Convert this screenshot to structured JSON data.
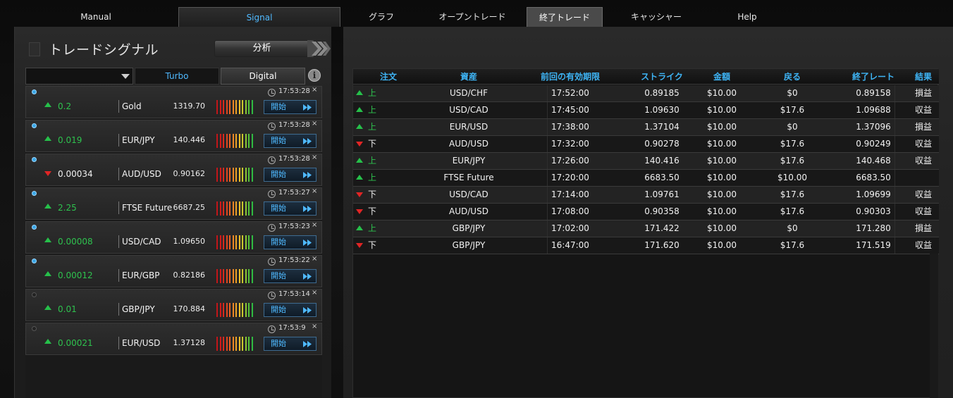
{
  "nav": {
    "tabs": [
      {
        "label": "Manual"
      },
      {
        "label": "Signal"
      },
      {
        "label": "グラフ"
      },
      {
        "label": "オープントレード"
      },
      {
        "label": "終了トレード"
      },
      {
        "label": "キャッシャー"
      },
      {
        "label": "Help"
      }
    ],
    "accent": "#4fb9ff"
  },
  "left": {
    "title": "トレードシグナル",
    "analyze_label": "分析",
    "filter": {
      "selected": "",
      "tab_turbo": "Turbo",
      "tab_digital": "Digital",
      "info": "i"
    },
    "signals": [
      {
        "time": "17:53:28",
        "change": "0.2",
        "dir": "up",
        "asset": "Gold",
        "price": "1319.70",
        "start": "開始",
        "active": true
      },
      {
        "time": "17:53:28",
        "change": "0.019",
        "dir": "up",
        "asset": "EUR/JPY",
        "price": "140.446",
        "start": "開始",
        "active": true
      },
      {
        "time": "17:53:28",
        "change": "0.00034",
        "dir": "down",
        "asset": "AUD/USD",
        "price": "0.90162",
        "start": "開始",
        "active": true
      },
      {
        "time": "17:53:27",
        "change": "2.25",
        "dir": "up",
        "asset": "FTSE Future",
        "price": "6687.25",
        "start": "開始",
        "active": true
      },
      {
        "time": "17:53:23",
        "change": "0.00008",
        "dir": "up",
        "asset": "USD/CAD",
        "price": "1.09650",
        "start": "開始",
        "active": true
      },
      {
        "time": "17:53:22",
        "change": "0.00012",
        "dir": "up",
        "asset": "EUR/GBP",
        "price": "0.82186",
        "start": "開始",
        "active": true
      },
      {
        "time": "17:53:14",
        "change": "0.01",
        "dir": "up",
        "asset": "GBP/JPY",
        "price": "170.884",
        "start": "開始",
        "active": false
      },
      {
        "time": "17:53:9",
        "change": "0.00021",
        "dir": "up",
        "asset": "EUR/USD",
        "price": "1.37128",
        "start": "開始",
        "active": false
      }
    ],
    "close_glyph": "×"
  },
  "table": {
    "headers": [
      "注文",
      "資産",
      "前回の有効期限",
      "ストライク",
      "金額",
      "戻る",
      "終了レート",
      "結果"
    ],
    "rows": [
      {
        "dir": "up",
        "dir_label": "上",
        "asset": "USD/CHF",
        "expiry": "17:52:00",
        "strike": "0.89185",
        "amount": "$10.00",
        "return": "$0",
        "close": "0.89158",
        "result": "損益"
      },
      {
        "dir": "up",
        "dir_label": "上",
        "asset": "USD/CAD",
        "expiry": "17:45:00",
        "strike": "1.09630",
        "amount": "$10.00",
        "return": "$17.6",
        "close": "1.09688",
        "result": "収益"
      },
      {
        "dir": "up",
        "dir_label": "上",
        "asset": "EUR/USD",
        "expiry": "17:38:00",
        "strike": "1.37104",
        "amount": "$10.00",
        "return": "$0",
        "close": "1.37096",
        "result": "損益"
      },
      {
        "dir": "down",
        "dir_label": "下",
        "asset": "AUD/USD",
        "expiry": "17:32:00",
        "strike": "0.90278",
        "amount": "$10.00",
        "return": "$17.6",
        "close": "0.90249",
        "result": "収益"
      },
      {
        "dir": "up",
        "dir_label": "上",
        "asset": "EUR/JPY",
        "expiry": "17:26:00",
        "strike": "140.416",
        "amount": "$10.00",
        "return": "$17.6",
        "close": "140.468",
        "result": "収益"
      },
      {
        "dir": "up",
        "dir_label": "上",
        "asset": "FTSE Future",
        "expiry": "17:20:00",
        "strike": "6683.50",
        "amount": "$10.00",
        "return": "$10.00",
        "close": "6683.50",
        "result": ""
      },
      {
        "dir": "down",
        "dir_label": "下",
        "asset": "USD/CAD",
        "expiry": "17:14:00",
        "strike": "1.09761",
        "amount": "$10.00",
        "return": "$17.6",
        "close": "1.09699",
        "result": "収益"
      },
      {
        "dir": "down",
        "dir_label": "下",
        "asset": "AUD/USD",
        "expiry": "17:08:00",
        "strike": "0.90358",
        "amount": "$10.00",
        "return": "$17.6",
        "close": "0.90303",
        "result": "収益"
      },
      {
        "dir": "up",
        "dir_label": "上",
        "asset": "GBP/JPY",
        "expiry": "17:02:00",
        "strike": "171.422",
        "amount": "$10.00",
        "return": "$0",
        "close": "171.280",
        "result": "損益"
      },
      {
        "dir": "down",
        "dir_label": "下",
        "asset": "GBP/JPY",
        "expiry": "16:47:00",
        "strike": "171.620",
        "amount": "$10.00",
        "return": "$17.6",
        "close": "171.519",
        "result": "収益"
      }
    ]
  },
  "colors": {
    "up": "#26c04a",
    "down": "#e02525",
    "accent": "#3eb4f5"
  }
}
